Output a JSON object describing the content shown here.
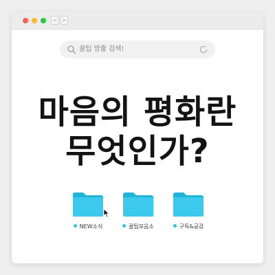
{
  "browser": {
    "back_glyph": "<",
    "forward_glyph": ">",
    "traffic_lights": {
      "close": "#fe5f57",
      "minimize": "#febb2e",
      "zoom": "#28c840"
    }
  },
  "search": {
    "text": "꿀팁 방출 검색!",
    "left_icon": "search-icon",
    "right_icon": "refresh-icon"
  },
  "headline": {
    "line1": "마음의 평화란",
    "line2": "무엇인가?"
  },
  "folders": [
    {
      "label": "NEW소식",
      "icon": "folder-icon"
    },
    {
      "label": "꿀팁모음소",
      "icon": "folder-icon"
    },
    {
      "label": "구독&공감",
      "icon": "folder-icon"
    }
  ],
  "colors": {
    "folder": "#29c3e6",
    "background": "#efefef"
  }
}
